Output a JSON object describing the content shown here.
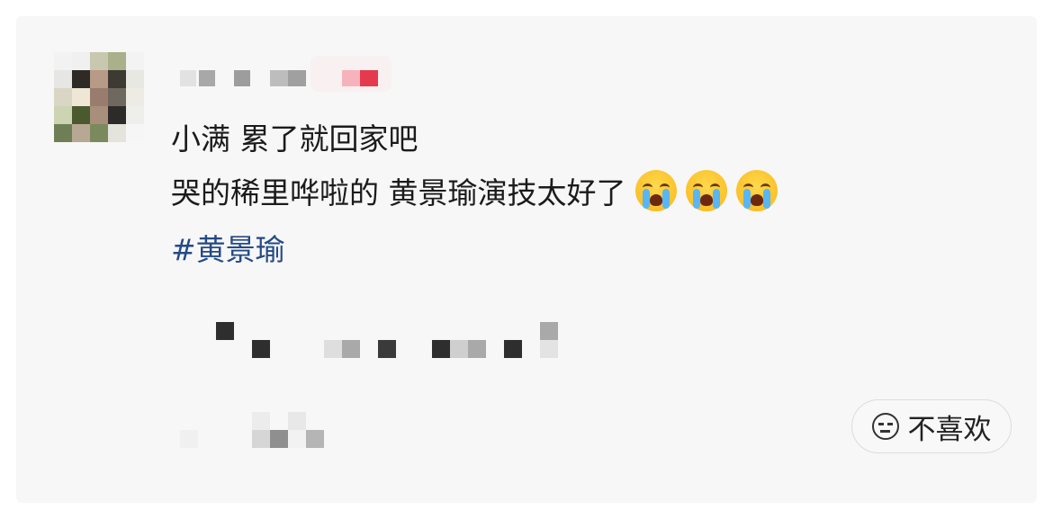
{
  "comment": {
    "line1": "小满 累了就回家吧",
    "line2": "哭的稀里哗啦的 黄景瑜演技太好了",
    "emojis": [
      "crying-face-emoji",
      "crying-face-emoji",
      "crying-face-emoji"
    ],
    "hashtag": "#黄景瑜"
  },
  "actions": {
    "dislike_label": "不喜欢",
    "dislike_icon": "neutral-face-icon"
  },
  "colors": {
    "hashtag": "#244a86",
    "text": "#1b1b1b",
    "card_bg": "#f7f7f7"
  }
}
